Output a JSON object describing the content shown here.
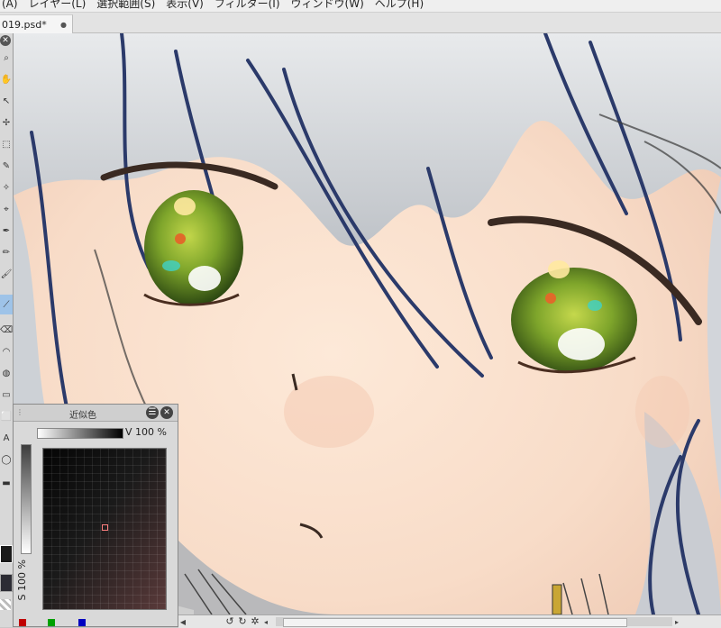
{
  "menubar": {
    "items": [
      {
        "label": "(A)"
      },
      {
        "label": "レイヤー(L)"
      },
      {
        "label": "選択範囲(S)"
      },
      {
        "label": "表示(V)"
      },
      {
        "label": "フィルター(I)"
      },
      {
        "label": "ウィンドウ(W)"
      },
      {
        "label": "ヘルプ(H)"
      }
    ]
  },
  "document_tab": {
    "title": "019.psd*"
  },
  "approx_palette": {
    "title": "近似色",
    "v_label": "V 100 %",
    "s_label": "S 100 %"
  },
  "colors": {
    "canvas_skin": "#f7e3d4",
    "eye_green": "#7ea52b",
    "hair_line": "#2b3a6a",
    "selected_tool": "#9ec3e8"
  }
}
